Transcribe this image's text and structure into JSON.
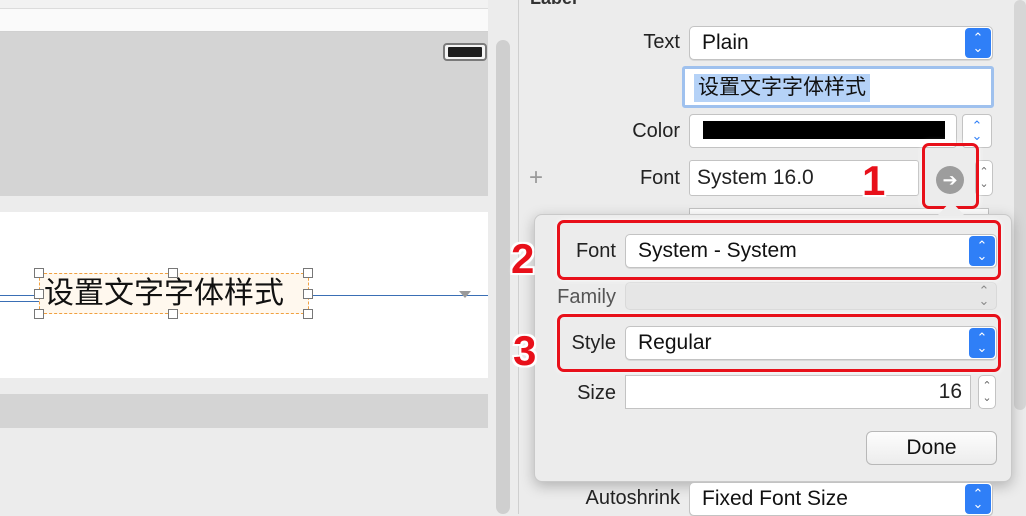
{
  "canvas": {
    "label_text": "设置文字字体样式"
  },
  "inspector": {
    "header_partial": "Label",
    "text_label": "Text",
    "text_type": "Plain",
    "text_value": "设置文字字体样式",
    "color_label": "Color",
    "color_value": "#000000",
    "font_label": "Font",
    "font_value": "System 16.0",
    "autoshrink_label": "Autoshrink",
    "autoshrink_value": "Fixed Font Size"
  },
  "popover": {
    "font_label": "Font",
    "font_value": "System - System",
    "family_label": "Family",
    "family_value": "",
    "style_label": "Style",
    "style_value": "Regular",
    "size_label": "Size",
    "size_value": "16",
    "done_label": "Done"
  },
  "annotations": {
    "step1": "1",
    "step2": "2",
    "step3": "3"
  },
  "icons": {
    "font_edit": "arrow-right-circle-icon",
    "add": "plus-icon",
    "select_arrows": "up-down-chevron-icon",
    "stepper": "stepper-icon"
  },
  "colors": {
    "accent": "#2f7ff7",
    "annotation": "#e8101a",
    "selection": "#b5d2f7",
    "guide": "#3a6fb5"
  }
}
